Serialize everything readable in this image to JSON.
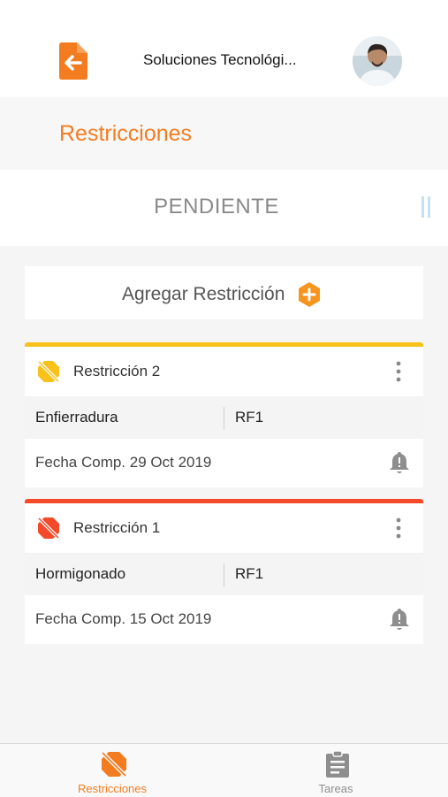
{
  "header": {
    "title": "Soluciones Tecnológi...",
    "accent_color": "#f47c20",
    "back_icon": "back-arrow-document-icon",
    "avatar_icon": "user-avatar"
  },
  "section": {
    "title": "Restricciones"
  },
  "status": {
    "label": "PENDIENTE",
    "side_icon": "pause-icon"
  },
  "add_card": {
    "label": "Agregar Restricción",
    "icon": "plus-circle-icon"
  },
  "restrictions": [
    {
      "name": "Restricción 2",
      "stripe_color": "#f8c21b",
      "icon": "restriction-icon",
      "activity": "Enfierradura",
      "code": "RF1",
      "date": "Fecha Comp. 29 Oct 2019"
    },
    {
      "name": "Restricción 1",
      "stripe_color": "#f44a2a",
      "icon": "restriction-icon",
      "activity": "Hormigonado",
      "code": "RF1",
      "date": "Fecha Comp. 15 Oct 2019"
    }
  ],
  "tabs": [
    {
      "label": "Restricciones",
      "active": true,
      "color": "#f47c20",
      "icon": "restriction-icon"
    },
    {
      "label": "Tareas",
      "active": false,
      "color": "#8e8e8e",
      "icon": "clipboard-icon"
    }
  ]
}
